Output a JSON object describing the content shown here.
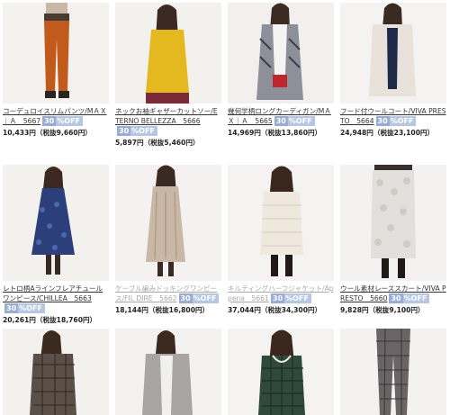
{
  "products": [
    {
      "title": "コーデュロイスリムパンツ/MＡＸ｜Ａ　5667",
      "discount": "30",
      "off": "%OFF",
      "price": "10,433円",
      "price_ex": "（税抜9,660円）",
      "faded": false
    },
    {
      "title": "ネックお袖ギャザーカットソー/ETERNO BELLEZZA　5666",
      "discount": "30",
      "off": "%OFF",
      "price": "5,897円",
      "price_ex": "（税抜5,460円）",
      "faded": false
    },
    {
      "title": "幾何学柄ロングカーディガン/MＡＸ｜Ａ　5665",
      "discount": "30",
      "off": "%OFF",
      "price": "14,969円",
      "price_ex": "（税抜13,860円）",
      "faded": false
    },
    {
      "title": "フード付ウールコート/VIVA PRESTO　5664",
      "discount": "30",
      "off": "%OFF",
      "price": "24,948円",
      "price_ex": "（税抜23,100円）",
      "faded": false
    },
    {
      "title": "レトロ柄Aラインフレアチュールワンピース/CHILLEA　5663",
      "discount": "30",
      "off": "%OFF",
      "price": "20,261円",
      "price_ex": "（税抜18,760円）",
      "faded": false
    },
    {
      "title": "ケーブル編みドッキングワンピース/FIL DIRE　5662",
      "discount": "30",
      "off": "%OFF",
      "price": "18,144円",
      "price_ex": "（税抜16,800円）",
      "faded": true
    },
    {
      "title": "キルティングハーフジャケット/Appena　5661",
      "discount": "30",
      "off": "%OFF",
      "price": "37,044円",
      "price_ex": "（税抜34,300円）",
      "faded": true
    },
    {
      "title": "ウール素材レーススカート/VIVA PRESTO　5660",
      "discount": "30",
      "off": "%OFF",
      "price": "9,828円",
      "price_ex": "（税抜9,100円）",
      "faded": false
    }
  ]
}
